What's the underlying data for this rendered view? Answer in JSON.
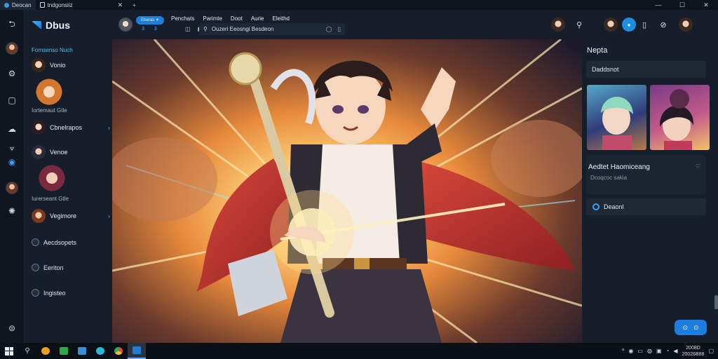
{
  "tabs": [
    {
      "label": "Deocan"
    },
    {
      "label": "tndgonsiiz"
    }
  ],
  "window_controls": {
    "minimize": "—",
    "maximize": "☐",
    "close": "✕"
  },
  "toolbar": {
    "pill": "Eberas ✶",
    "pill_sub": "3 3",
    "menu": [
      "Penchats",
      "Parimte",
      "Doot",
      "Aurie",
      "Eleithd"
    ],
    "icons": [
      "◫",
      "◩",
      "▭"
    ],
    "search_value": "Ouzeri Eeosngi Besdeon",
    "search_icon": "search-icon",
    "right_badge": "●"
  },
  "sidebar": {
    "brand": "Dbus",
    "section_title": "Fornsenso Nuch",
    "items": [
      {
        "label": "Vonio"
      },
      {
        "label": "Cbnelrapos"
      },
      {
        "label": "Venoe"
      },
      {
        "label": "Vegimore"
      }
    ],
    "sub_labels": [
      "Iortemaut Gtle",
      "Iurerseant Gtle"
    ],
    "radio_items": [
      "Aecdsopets",
      "Eeriton",
      "Ingisteo"
    ]
  },
  "right_panel": {
    "title": "Nepta",
    "field": "Daddsnot",
    "card_title": "Aedtet Haomiceang",
    "card_sub": "Dcoqcoc sakia",
    "button": "Deaonl",
    "chip_icons": [
      "⊙",
      "⊙"
    ]
  },
  "taskbar": {
    "icons": [
      "search-icon",
      "browser-icon",
      "app-green",
      "app-blue",
      "app-cyan",
      "chrome-icon",
      "active-app-icon"
    ],
    "tray_icons": [
      "^",
      "◉",
      "▭",
      "◍",
      "▣",
      "◔",
      "◀"
    ],
    "clock_line1": "2008D",
    "clock_line2": "20026B88"
  },
  "colors": {
    "accent": "#1f7fd8",
    "panel": "#151e2a",
    "background": "#111a26"
  }
}
